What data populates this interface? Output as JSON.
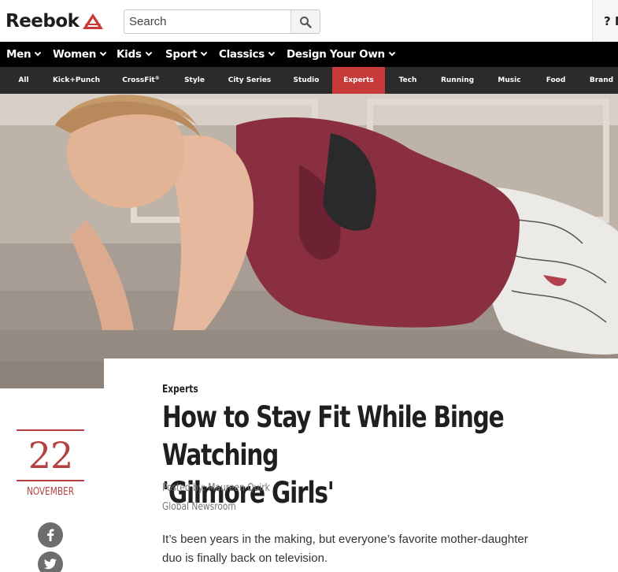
{
  "header": {
    "brand": "Reebok",
    "search_placeholder": "Search",
    "help_label": "? N"
  },
  "main_nav": [
    {
      "label": "Men"
    },
    {
      "label": "Women"
    },
    {
      "label": "Kids"
    },
    {
      "label": "Sport"
    },
    {
      "label": "Classics"
    },
    {
      "label": "Design Your Own"
    }
  ],
  "sub_nav": [
    {
      "label": "All"
    },
    {
      "label": "Kick+Punch"
    },
    {
      "label": "CrossFit",
      "superscript": "®"
    },
    {
      "label": "Style"
    },
    {
      "label": "City Series"
    },
    {
      "label": "Studio"
    },
    {
      "label": "Experts",
      "active": true
    },
    {
      "label": "Tech"
    },
    {
      "label": "Running"
    },
    {
      "label": "Music"
    },
    {
      "label": "Food"
    },
    {
      "label": "Brand"
    }
  ],
  "article": {
    "date_day": "22",
    "date_month": "NOVEMBER",
    "category": "Experts",
    "title_line1": "How to Stay Fit While Binge Watching",
    "title_line2": "'Gilmore Girls'",
    "posted_by": "Posted by: Maureen Quirk",
    "newsroom": "Global Newsroom",
    "lede_line1": "It’s been years in the making, but everyone’s favorite mother-daughter",
    "lede_line2": "duo is finally back on television."
  },
  "social": [
    {
      "icon": "facebook-icon"
    },
    {
      "icon": "twitter-icon"
    }
  ],
  "colors": {
    "accent_red": "#c73a3a",
    "date_red": "#b44242",
    "nav_black": "#000000",
    "subnav_gray": "#2b2b2b"
  }
}
